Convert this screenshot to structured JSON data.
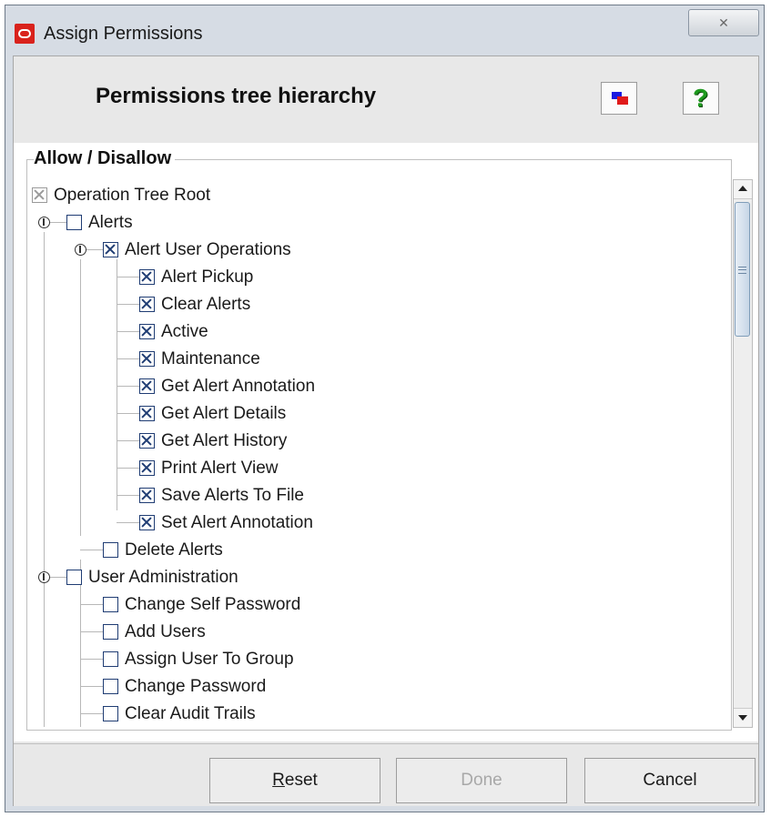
{
  "window": {
    "title": "Assign Permissions",
    "close_glyph": "✕"
  },
  "header": {
    "title": "Permissions tree hierarchy",
    "color_icon": "color-swatch-icon",
    "help_icon": "help-icon",
    "help_glyph": "?"
  },
  "group": {
    "label": "Allow / Disallow"
  },
  "tree": {
    "items": [
      {
        "label": "Operation Tree Root",
        "checked": true,
        "level": 0
      },
      {
        "label": "Alerts",
        "checked": false,
        "level": 1
      },
      {
        "label": "Alert User Operations",
        "checked": true,
        "level": 2
      },
      {
        "label": "Alert Pickup",
        "checked": true,
        "level": 3
      },
      {
        "label": "Clear Alerts",
        "checked": true,
        "level": 3
      },
      {
        "label": "Active",
        "checked": true,
        "level": 3
      },
      {
        "label": "Maintenance",
        "checked": true,
        "level": 3
      },
      {
        "label": "Get Alert Annotation",
        "checked": true,
        "level": 3
      },
      {
        "label": "Get Alert Details",
        "checked": true,
        "level": 3
      },
      {
        "label": "Get Alert History",
        "checked": true,
        "level": 3
      },
      {
        "label": "Print Alert View",
        "checked": true,
        "level": 3
      },
      {
        "label": "Save Alerts To File",
        "checked": true,
        "level": 3
      },
      {
        "label": "Set Alert Annotation",
        "checked": true,
        "level": 3
      },
      {
        "label": "Delete Alerts",
        "checked": false,
        "level": 2
      },
      {
        "label": "User Administration",
        "checked": false,
        "level": 1
      },
      {
        "label": "Change Self Password",
        "checked": false,
        "level": 2
      },
      {
        "label": "Add Users",
        "checked": false,
        "level": 2
      },
      {
        "label": "Assign User To Group",
        "checked": false,
        "level": 2
      },
      {
        "label": "Change Password",
        "checked": false,
        "level": 2
      },
      {
        "label": "Clear Audit Trails",
        "checked": false,
        "level": 2
      }
    ]
  },
  "buttons": {
    "reset_rest": "eset",
    "reset_mnemonic": "R",
    "done": "Done",
    "cancel": "Cancel"
  },
  "colors": {
    "title_bar": "#d6dce4",
    "checkbox": "#1f3c73",
    "scroll_thumb": "#c7d6e6"
  }
}
